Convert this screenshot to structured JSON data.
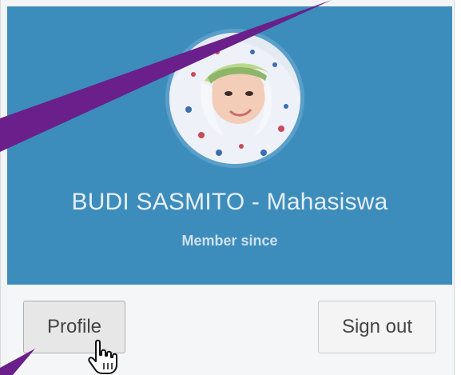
{
  "user_menu": {
    "name": "BUDI SASMITO - Mahasiswa",
    "member_since_label": "Member since",
    "avatar_icon": "user-avatar-photo",
    "profile_button_label": "Profile",
    "signout_button_label": "Sign out",
    "cursor_icon": "hand-pointer-icon"
  },
  "colors": {
    "header_bg": "#3c8dbc",
    "footer_bg": "#f5f6f8",
    "annotation_stroke": "#6a1f8a"
  }
}
